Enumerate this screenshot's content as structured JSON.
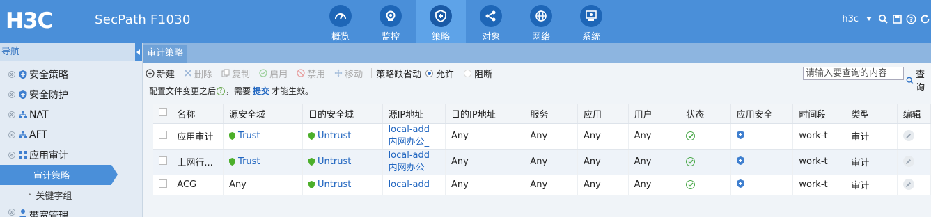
{
  "header": {
    "logo_text": "H3C",
    "product": "SecPath F1030",
    "nav": [
      {
        "label": "概览",
        "icon": "gauge-icon"
      },
      {
        "label": "监控",
        "icon": "webcam-icon"
      },
      {
        "label": "策略",
        "icon": "shield-plus-icon",
        "active": true
      },
      {
        "label": "对象",
        "icon": "share-nodes-icon"
      },
      {
        "label": "网络",
        "icon": "globe-icon"
      },
      {
        "label": "系统",
        "icon": "monitor-gear-icon"
      }
    ],
    "user": "h3c"
  },
  "sidebar": {
    "title": "导航",
    "items": [
      {
        "label": "安全策略",
        "icon": "shield-icon"
      },
      {
        "label": "安全防护",
        "icon": "shield-icon"
      },
      {
        "label": "NAT",
        "icon": "network-icon"
      },
      {
        "label": "AFT",
        "icon": "network-icon"
      },
      {
        "label": "应用审计",
        "icon": "grid-icon"
      }
    ],
    "sub_items": [
      {
        "label": "审计策略",
        "active": true
      },
      {
        "label": "关键字组"
      }
    ],
    "partial_item": {
      "label": "带宽管理",
      "icon": "user-icon"
    }
  },
  "main": {
    "tab": "审计策略",
    "toolbar": {
      "new": "新建",
      "delete": "删除",
      "copy": "复制",
      "enable": "启用",
      "disable": "禁用",
      "move": "移动",
      "default_action_label": "策略缺省动",
      "allow": "允许",
      "block": "阻断",
      "search_placeholder": "请输入要查询的内容",
      "search": "查询"
    },
    "notice": {
      "before": "配置文件变更之后",
      "q": "?",
      "middle": "，需要",
      "link": "提交",
      "after": "才能生效。"
    },
    "table": {
      "headers": [
        "名称",
        "源安全域",
        "目的安全域",
        "源IP地址",
        "目的IP地址",
        "服务",
        "应用",
        "用户",
        "状态",
        "应用安全",
        "时间段",
        "类型",
        "编辑"
      ],
      "rows": [
        {
          "name": "应用审计",
          "src_zone": "Trust",
          "dst_zone": "Untrust",
          "src_ip": [
            "local-add",
            "内网办公_"
          ],
          "dst_ip": "Any",
          "service": "Any",
          "app": "Any",
          "user": "Any",
          "time": "work-t",
          "type": "审计"
        },
        {
          "name": "上网行...",
          "src_zone": "Trust",
          "dst_zone": "Untrust",
          "src_ip": [
            "local-add",
            "内网办公_"
          ],
          "dst_ip": "Any",
          "service": "Any",
          "app": "Any",
          "user": "Any",
          "time": "work-t",
          "type": "审计"
        },
        {
          "name": "ACG",
          "src_zone": "Any",
          "dst_zone": "Untrust",
          "src_ip": [
            "local-add"
          ],
          "dst_ip": "Any",
          "service": "Any",
          "app": "Any",
          "user": "Any",
          "time": "work-t",
          "type": "审计"
        }
      ]
    }
  },
  "colors": {
    "topbar": "#4a8fd9",
    "link": "#2166c0",
    "status_ok": "#4aa84a",
    "zone_shield": "#4caf2b"
  }
}
